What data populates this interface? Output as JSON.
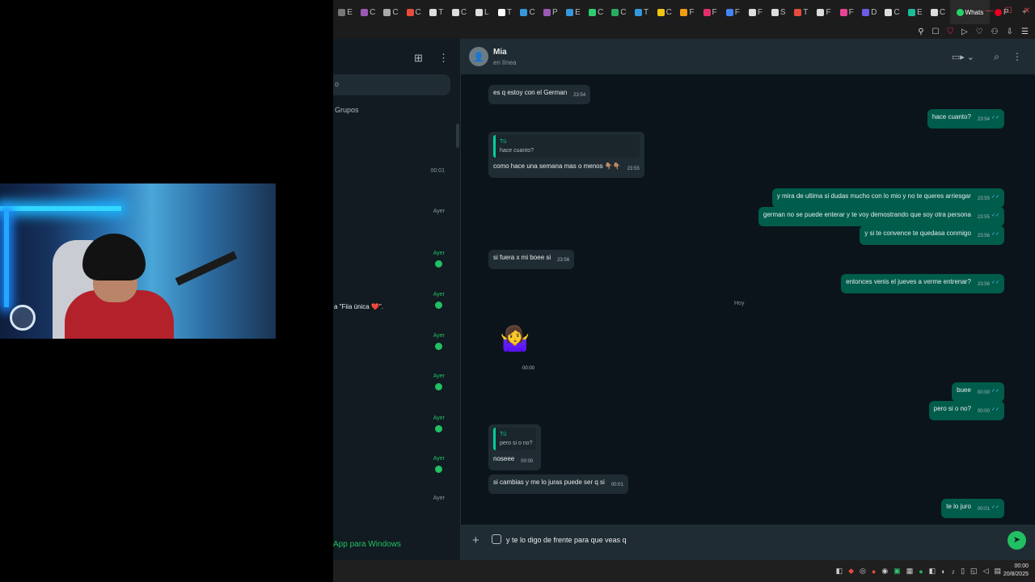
{
  "browser": {
    "tabs": [
      {
        "label": "E",
        "color": "#777"
      },
      {
        "label": "C",
        "color": "#9b59b6"
      },
      {
        "label": "C",
        "color": "#aaa"
      },
      {
        "label": "C",
        "color": "#e74c3c"
      },
      {
        "label": "T",
        "color": "#ddd"
      },
      {
        "label": "C",
        "color": "#ddd"
      },
      {
        "label": "L",
        "color": "#ddd"
      },
      {
        "label": "T",
        "color": "#fff"
      },
      {
        "label": "C",
        "color": "#3498db"
      },
      {
        "label": "P",
        "color": "#9b59b6"
      },
      {
        "label": "E",
        "color": "#3498db"
      },
      {
        "label": "C",
        "color": "#2ecc71"
      },
      {
        "label": "C",
        "color": "#27ae60"
      },
      {
        "label": "T",
        "color": "#3498db"
      },
      {
        "label": "C",
        "color": "#f1c40f"
      },
      {
        "label": "F",
        "color": "#f39c12"
      },
      {
        "label": "F",
        "color": "#e1306c"
      },
      {
        "label": "F",
        "color": "#4285f4"
      },
      {
        "label": "F",
        "color": "#ddd"
      },
      {
        "label": "S",
        "color": "#ddd"
      },
      {
        "label": "T",
        "color": "#e74c3c"
      },
      {
        "label": "F",
        "color": "#ddd"
      },
      {
        "label": "F",
        "color": "#e84393"
      },
      {
        "label": "D",
        "color": "#6c5ce7"
      },
      {
        "label": "C",
        "color": "#ddd"
      },
      {
        "label": "E",
        "color": "#1abc9c"
      },
      {
        "label": "C",
        "color": "#ddd"
      }
    ],
    "active_tab": "Whats",
    "after_tab": "P"
  },
  "left_panel": {
    "search_text": "o",
    "filter": "Grupos",
    "rows": [
      {
        "time": "00:01",
        "unread": false,
        "badge": false,
        "preview": ""
      },
      {
        "time": "Ayer",
        "unread": false,
        "badge": false,
        "preview": ""
      },
      {
        "time": "Ayer",
        "unread": true,
        "badge": true,
        "preview": ""
      },
      {
        "time": "Ayer",
        "unread": true,
        "badge": true,
        "preview": "a \"Fiia única ❤️\"."
      },
      {
        "time": "Ayer",
        "unread": true,
        "badge": true,
        "preview": ""
      },
      {
        "time": "Ayer",
        "unread": true,
        "badge": true,
        "preview": ""
      },
      {
        "time": "Ayer",
        "unread": true,
        "badge": true,
        "preview": ""
      },
      {
        "time": "Ayer",
        "unread": true,
        "badge": true,
        "preview": ""
      },
      {
        "time": "Ayer",
        "unread": false,
        "badge": false,
        "preview": ""
      }
    ],
    "footer": "App para Windows"
  },
  "chat": {
    "contact_name": "Mia",
    "contact_status": "en línea",
    "day_separator": "Hoy",
    "sticker": "🤷‍♀️",
    "sticker_time": "00:00",
    "messages": [
      {
        "dir": "in",
        "text": "es q estoy con el German",
        "time": "23:54"
      },
      {
        "dir": "out",
        "text": "hace cuanto?",
        "time": "23:54"
      },
      {
        "dir": "in",
        "quote_who": "Tú",
        "quote_text": "hace cuanto?",
        "text": "como hace una semana mas o menos 👇🏽👇🏽",
        "time": "23:55"
      },
      {
        "dir": "out",
        "text": "y mira de ultima si dudas mucho con lo mio y no te queres arriesgar",
        "time": "23:55"
      },
      {
        "dir": "out",
        "text": "german no se puede enterar y te voy demostrando que soy otra persona",
        "time": "23:55"
      },
      {
        "dir": "out",
        "text": "y si te convence te quedasa conmigo",
        "time": "23:56"
      },
      {
        "dir": "in",
        "text": "si fuera x mi boee si",
        "time": "23:56"
      },
      {
        "dir": "out",
        "text": "entonces venis el jueves a verme entrenar?",
        "time": "23:56"
      },
      {
        "dir": "out",
        "text": "buee",
        "time": "00:00"
      },
      {
        "dir": "out",
        "text": "pero si o no?",
        "time": "00:00"
      },
      {
        "dir": "in",
        "quote_who": "Tú",
        "quote_text": "pero si o no?",
        "text": "noseee",
        "time": "00:00"
      },
      {
        "dir": "in",
        "text": "si cambias y me lo juras puede ser q si",
        "time": "00:01"
      },
      {
        "dir": "out",
        "text": "te lo juro",
        "time": "00:01"
      }
    ],
    "composer_text": "y te lo digo de frente para que veas q"
  },
  "taskbar": {
    "clock_time": "00:00",
    "clock_date": "20/8/2025"
  },
  "colors": {
    "accent": "#21c063",
    "outgoing_bubble": "#005c4b",
    "incoming_bubble": "#202c33",
    "chat_bg": "#0b141a"
  }
}
